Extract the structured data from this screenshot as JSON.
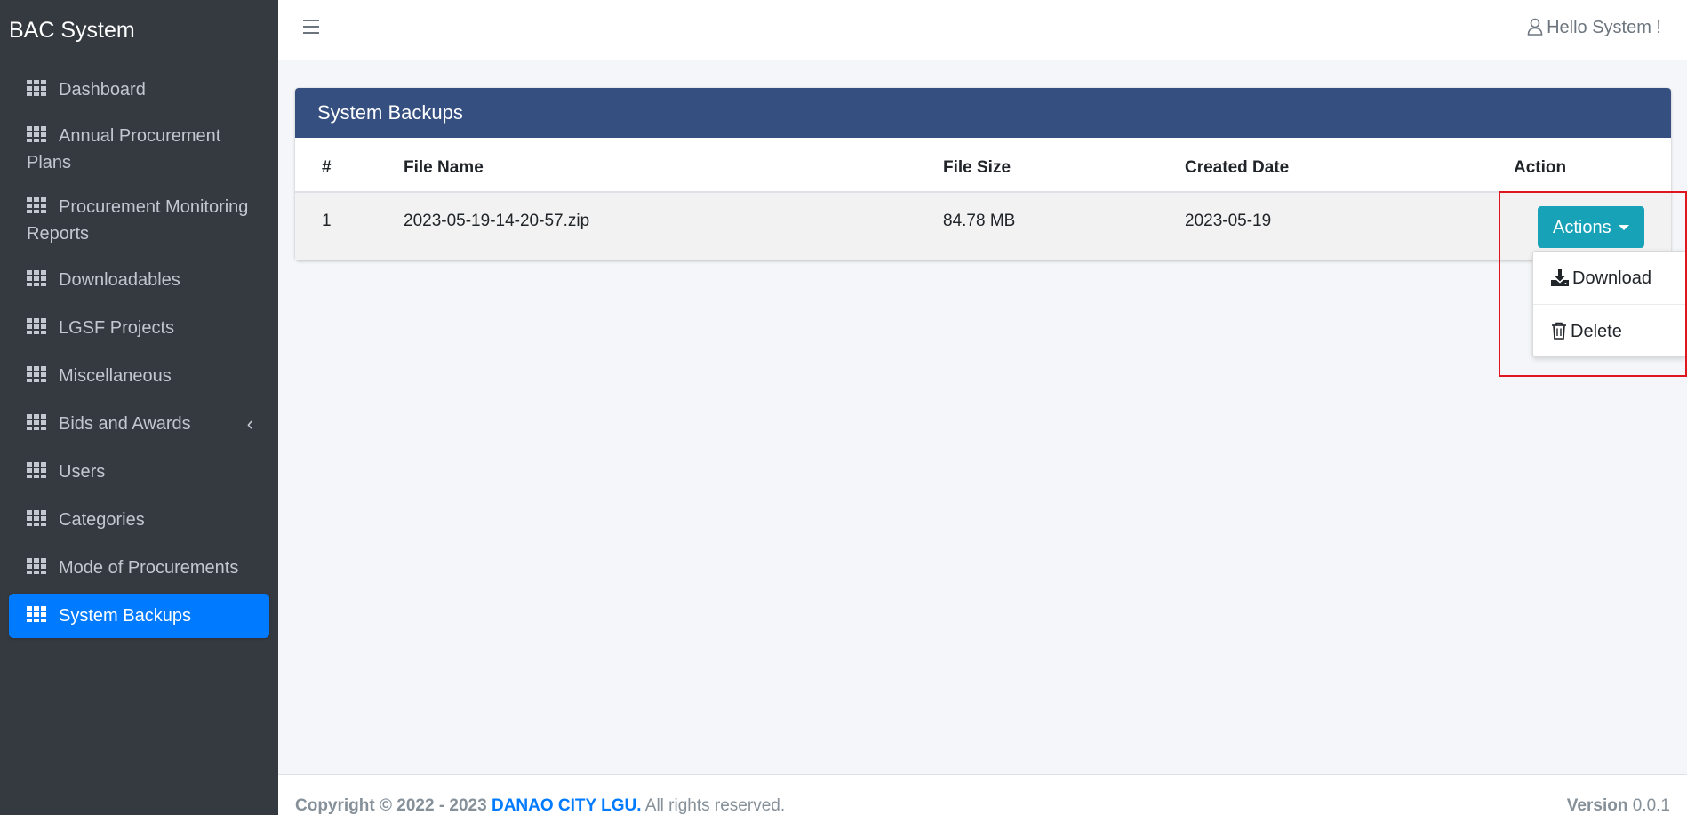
{
  "app": {
    "brand": "BAC System"
  },
  "sidebar": {
    "items": [
      {
        "label": "Dashboard"
      },
      {
        "label": "Annual Procurement Plans"
      },
      {
        "label": "Procurement Monitoring Reports"
      },
      {
        "label": "Downloadables"
      },
      {
        "label": "LGSF Projects"
      },
      {
        "label": "Miscellaneous"
      },
      {
        "label": "Bids and Awards"
      },
      {
        "label": "Users"
      },
      {
        "label": "Categories"
      },
      {
        "label": "Mode of Procurements"
      },
      {
        "label": "System Backups"
      }
    ],
    "active": "System Backups"
  },
  "topbar": {
    "greeting": "Hello System !"
  },
  "card": {
    "title": "System Backups",
    "columns": [
      "#",
      "File Name",
      "File Size",
      "Created Date",
      "Action"
    ],
    "rows": [
      {
        "num": "1",
        "file_name": "2023-05-19-14-20-57.zip",
        "file_size": "84.78 MB",
        "created_date": "2023-05-19"
      }
    ]
  },
  "actions": {
    "button_label": "Actions",
    "menu": [
      {
        "label": "Download",
        "icon": "download-icon"
      },
      {
        "label": "Delete",
        "icon": "trash-icon"
      }
    ]
  },
  "footer": {
    "copyright": "Copyright © 2022 - 2023",
    "org": "DANAO CITY LGU.",
    "rights": "All rights reserved.",
    "version_label": "Version",
    "version": "0.0.1"
  },
  "colors": {
    "sidebar_bg": "#343a40",
    "active_item": "#007bff",
    "card_header": "#355080",
    "actions_button": "#17a2b8",
    "highlight_box": "#e0161f"
  }
}
